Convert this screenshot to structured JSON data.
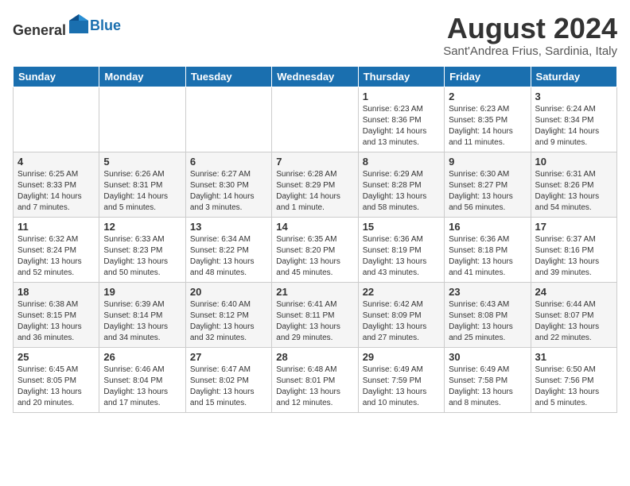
{
  "header": {
    "logo": {
      "text_general": "General",
      "text_blue": "Blue"
    },
    "month": "August 2024",
    "location": "Sant'Andrea Frius, Sardinia, Italy"
  },
  "weekdays": [
    "Sunday",
    "Monday",
    "Tuesday",
    "Wednesday",
    "Thursday",
    "Friday",
    "Saturday"
  ],
  "weeks": [
    [
      {
        "day": "",
        "details": ""
      },
      {
        "day": "",
        "details": ""
      },
      {
        "day": "",
        "details": ""
      },
      {
        "day": "",
        "details": ""
      },
      {
        "day": "1",
        "details": "Sunrise: 6:23 AM\nSunset: 8:36 PM\nDaylight: 14 hours\nand 13 minutes."
      },
      {
        "day": "2",
        "details": "Sunrise: 6:23 AM\nSunset: 8:35 PM\nDaylight: 14 hours\nand 11 minutes."
      },
      {
        "day": "3",
        "details": "Sunrise: 6:24 AM\nSunset: 8:34 PM\nDaylight: 14 hours\nand 9 minutes."
      }
    ],
    [
      {
        "day": "4",
        "details": "Sunrise: 6:25 AM\nSunset: 8:33 PM\nDaylight: 14 hours\nand 7 minutes."
      },
      {
        "day": "5",
        "details": "Sunrise: 6:26 AM\nSunset: 8:31 PM\nDaylight: 14 hours\nand 5 minutes."
      },
      {
        "day": "6",
        "details": "Sunrise: 6:27 AM\nSunset: 8:30 PM\nDaylight: 14 hours\nand 3 minutes."
      },
      {
        "day": "7",
        "details": "Sunrise: 6:28 AM\nSunset: 8:29 PM\nDaylight: 14 hours\nand 1 minute."
      },
      {
        "day": "8",
        "details": "Sunrise: 6:29 AM\nSunset: 8:28 PM\nDaylight: 13 hours\nand 58 minutes."
      },
      {
        "day": "9",
        "details": "Sunrise: 6:30 AM\nSunset: 8:27 PM\nDaylight: 13 hours\nand 56 minutes."
      },
      {
        "day": "10",
        "details": "Sunrise: 6:31 AM\nSunset: 8:26 PM\nDaylight: 13 hours\nand 54 minutes."
      }
    ],
    [
      {
        "day": "11",
        "details": "Sunrise: 6:32 AM\nSunset: 8:24 PM\nDaylight: 13 hours\nand 52 minutes."
      },
      {
        "day": "12",
        "details": "Sunrise: 6:33 AM\nSunset: 8:23 PM\nDaylight: 13 hours\nand 50 minutes."
      },
      {
        "day": "13",
        "details": "Sunrise: 6:34 AM\nSunset: 8:22 PM\nDaylight: 13 hours\nand 48 minutes."
      },
      {
        "day": "14",
        "details": "Sunrise: 6:35 AM\nSunset: 8:20 PM\nDaylight: 13 hours\nand 45 minutes."
      },
      {
        "day": "15",
        "details": "Sunrise: 6:36 AM\nSunset: 8:19 PM\nDaylight: 13 hours\nand 43 minutes."
      },
      {
        "day": "16",
        "details": "Sunrise: 6:36 AM\nSunset: 8:18 PM\nDaylight: 13 hours\nand 41 minutes."
      },
      {
        "day": "17",
        "details": "Sunrise: 6:37 AM\nSunset: 8:16 PM\nDaylight: 13 hours\nand 39 minutes."
      }
    ],
    [
      {
        "day": "18",
        "details": "Sunrise: 6:38 AM\nSunset: 8:15 PM\nDaylight: 13 hours\nand 36 minutes."
      },
      {
        "day": "19",
        "details": "Sunrise: 6:39 AM\nSunset: 8:14 PM\nDaylight: 13 hours\nand 34 minutes."
      },
      {
        "day": "20",
        "details": "Sunrise: 6:40 AM\nSunset: 8:12 PM\nDaylight: 13 hours\nand 32 minutes."
      },
      {
        "day": "21",
        "details": "Sunrise: 6:41 AM\nSunset: 8:11 PM\nDaylight: 13 hours\nand 29 minutes."
      },
      {
        "day": "22",
        "details": "Sunrise: 6:42 AM\nSunset: 8:09 PM\nDaylight: 13 hours\nand 27 minutes."
      },
      {
        "day": "23",
        "details": "Sunrise: 6:43 AM\nSunset: 8:08 PM\nDaylight: 13 hours\nand 25 minutes."
      },
      {
        "day": "24",
        "details": "Sunrise: 6:44 AM\nSunset: 8:07 PM\nDaylight: 13 hours\nand 22 minutes."
      }
    ],
    [
      {
        "day": "25",
        "details": "Sunrise: 6:45 AM\nSunset: 8:05 PM\nDaylight: 13 hours\nand 20 minutes."
      },
      {
        "day": "26",
        "details": "Sunrise: 6:46 AM\nSunset: 8:04 PM\nDaylight: 13 hours\nand 17 minutes."
      },
      {
        "day": "27",
        "details": "Sunrise: 6:47 AM\nSunset: 8:02 PM\nDaylight: 13 hours\nand 15 minutes."
      },
      {
        "day": "28",
        "details": "Sunrise: 6:48 AM\nSunset: 8:01 PM\nDaylight: 13 hours\nand 12 minutes."
      },
      {
        "day": "29",
        "details": "Sunrise: 6:49 AM\nSunset: 7:59 PM\nDaylight: 13 hours\nand 10 minutes."
      },
      {
        "day": "30",
        "details": "Sunrise: 6:49 AM\nSunset: 7:58 PM\nDaylight: 13 hours\nand 8 minutes."
      },
      {
        "day": "31",
        "details": "Sunrise: 6:50 AM\nSunset: 7:56 PM\nDaylight: 13 hours\nand 5 minutes."
      }
    ]
  ]
}
